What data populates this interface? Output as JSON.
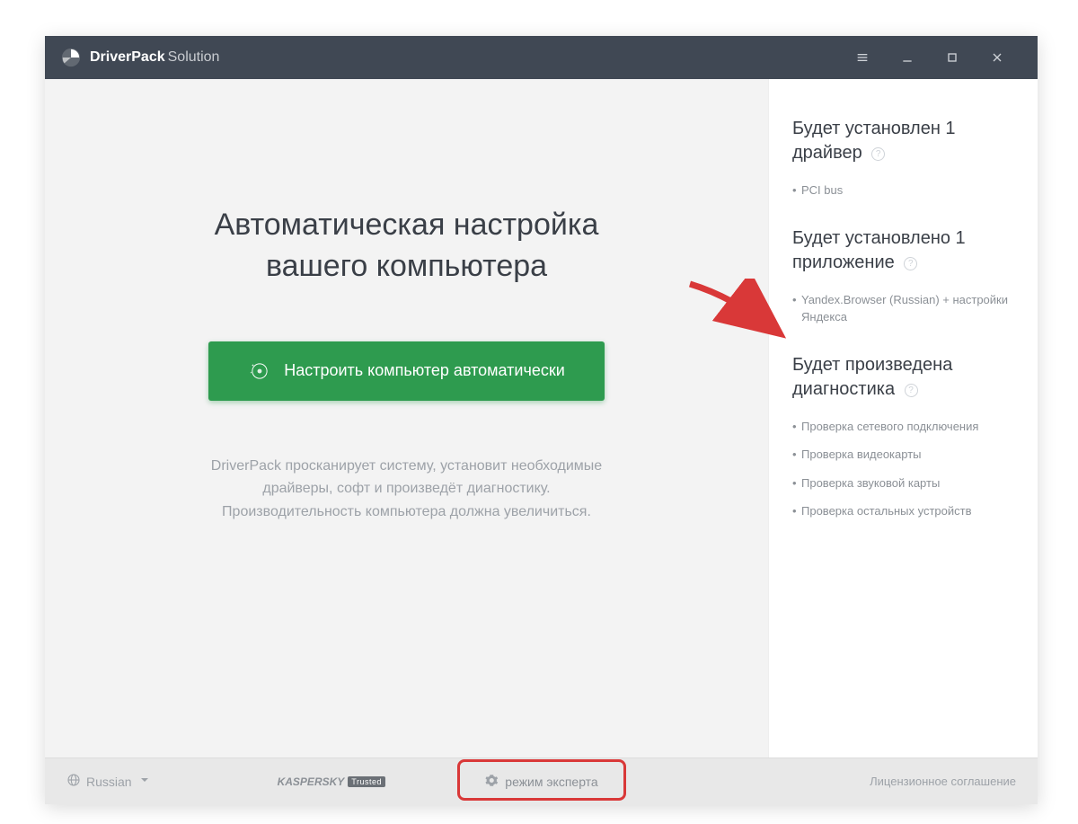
{
  "titlebar": {
    "brand_bold": "DriverPack",
    "brand_light": "Solution"
  },
  "main": {
    "headline_line1": "Автоматическая настройка",
    "headline_line2": "вашего компьютера",
    "cta_label": "Настроить компьютер автоматически",
    "sub_line1": "DriverPack просканирует систему, установит необходимые",
    "sub_line2": "драйверы, софт и произведёт диагностику.",
    "sub_line3": "Производительность компьютера должна увеличиться."
  },
  "sidebar": {
    "s1_title": "Будет установлен 1 драйвер",
    "s1_items": [
      "PCI bus"
    ],
    "s2_title": "Будет установлено 1 приложение",
    "s2_items": [
      "Yandex.Browser (Russian) + настройки Яндекса"
    ],
    "s3_title": "Будет произведена диагностика",
    "s3_items": [
      "Проверка сетевого подключения",
      "Проверка видеокарты",
      "Проверка звуковой карты",
      "Проверка остальных устройств"
    ],
    "help_glyph": "?"
  },
  "footer": {
    "language": "Russian",
    "kaspersky_label": "KASPERSKY",
    "kaspersky_badge": "Trusted",
    "expert_label": "режим эксперта",
    "license_label": "Лицензионное соглашение"
  }
}
